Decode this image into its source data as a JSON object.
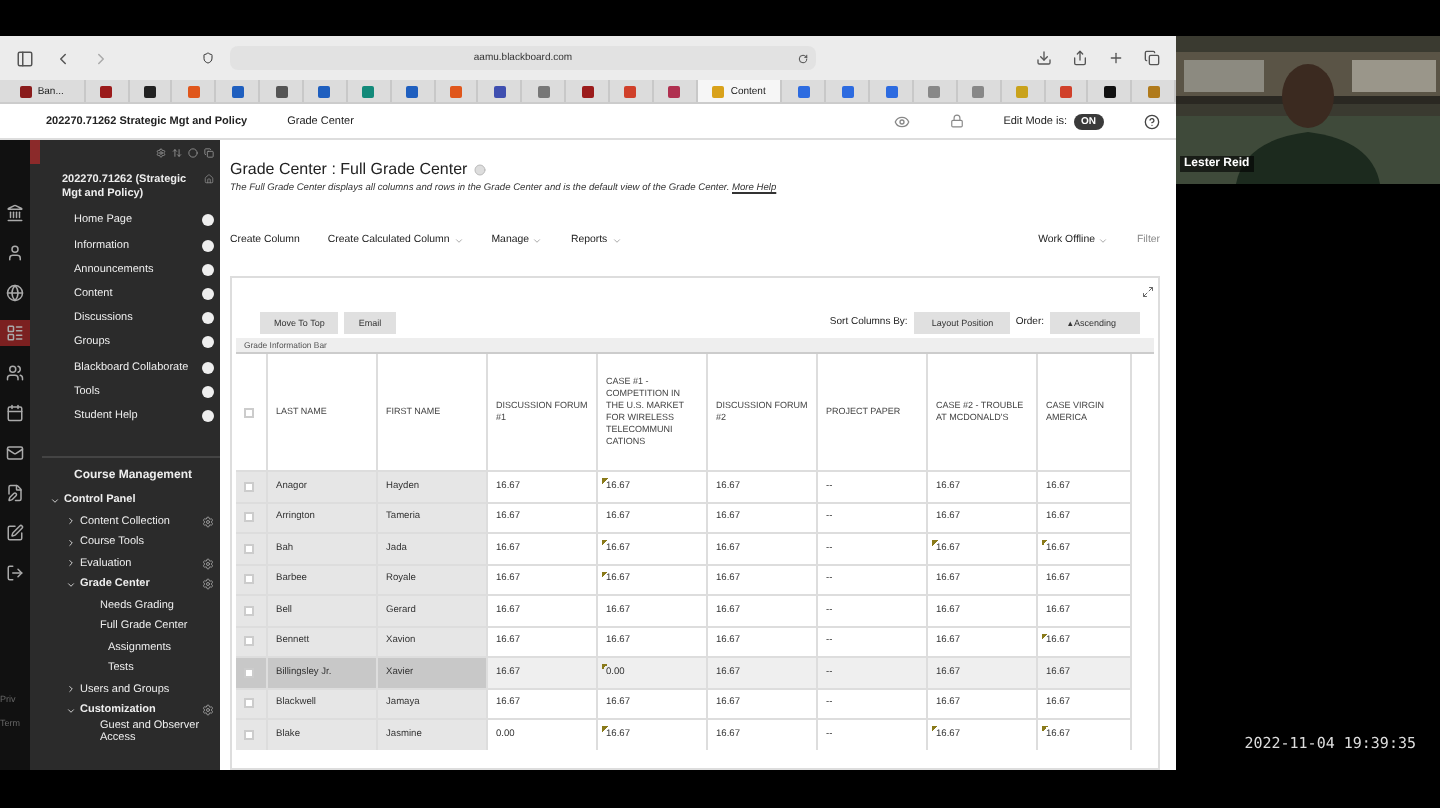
{
  "browser": {
    "address": "aamu.blackboard.com",
    "tabs": [
      {
        "label": "Ban...",
        "selected": false,
        "color": "#8a1c1c"
      },
      {
        "selected": false,
        "color": "#9b1b1b"
      },
      {
        "selected": false,
        "color": "#222222"
      },
      {
        "selected": false,
        "color": "#e0561b"
      },
      {
        "selected": false,
        "color": "#1f5fbf"
      },
      {
        "selected": false,
        "color": "#555555"
      },
      {
        "selected": false,
        "color": "#1f5fbf"
      },
      {
        "selected": false,
        "color": "#138a7a"
      },
      {
        "selected": false,
        "color": "#1f5fbf"
      },
      {
        "selected": false,
        "color": "#e0561b"
      },
      {
        "selected": false,
        "color": "#3f4fb0"
      },
      {
        "selected": false,
        "color": "#777777"
      },
      {
        "selected": false,
        "color": "#9b1b1b"
      },
      {
        "selected": false,
        "color": "#d0402a"
      },
      {
        "selected": false,
        "color": "#b03050"
      },
      {
        "label": "Content",
        "selected": true,
        "color": "#d9a21b"
      },
      {
        "selected": false,
        "color": "#2d6be0"
      },
      {
        "selected": false,
        "color": "#2d6be0"
      },
      {
        "selected": false,
        "color": "#2d6be0"
      },
      {
        "selected": false,
        "color": "#888888"
      },
      {
        "selected": false,
        "color": "#888888"
      },
      {
        "selected": false,
        "color": "#c9a21b"
      },
      {
        "selected": false,
        "color": "#d0402a"
      },
      {
        "selected": false,
        "color": "#111111"
      },
      {
        "selected": false,
        "color": "#b07a1b"
      }
    ]
  },
  "header": {
    "course": "202270.71262 Strategic Mgt and Policy",
    "crumb": "Grade Center",
    "edit_mode_label": "Edit Mode is:",
    "edit_mode_on": true,
    "edit_mode_text": "ON"
  },
  "rail": {
    "footer": [
      "Priv",
      "Term"
    ]
  },
  "sidebar": {
    "course_title": "202270.71262 (Strategic Mgt and Policy)",
    "menu": [
      "Home Page",
      "Information",
      "Announcements",
      "Content",
      "Discussions",
      "Groups",
      "Blackboard Collaborate",
      "Tools",
      "Student Help"
    ],
    "management_title": "Course Management",
    "tree": [
      {
        "label": "Control Panel",
        "expanded": true,
        "children": [
          {
            "label": "Content Collection",
            "expanded": false,
            "gear": true
          },
          {
            "label": "Course Tools",
            "expanded": false,
            "gear": false
          },
          {
            "label": "Evaluation",
            "expanded": false,
            "gear": true
          },
          {
            "label": "Grade Center",
            "expanded": true,
            "gear": true,
            "children": [
              {
                "label": "Needs Grading"
              },
              {
                "label": "Full Grade Center",
                "children": [
                  {
                    "label": "Assignments"
                  },
                  {
                    "label": "Tests"
                  }
                ]
              }
            ]
          },
          {
            "label": "Users and Groups",
            "expanded": false,
            "gear": false
          },
          {
            "label": "Customization",
            "expanded": true,
            "gear": true,
            "children": [
              {
                "label": "Guest and Observer Access"
              }
            ]
          }
        ]
      }
    ]
  },
  "page": {
    "title": "Grade Center : Full Grade Center",
    "description": "The Full Grade Center displays all columns and rows in the Grade Center and is the default view of the Grade Center.",
    "help_link": "More Help",
    "actions": [
      {
        "label": "Create Column",
        "menu": false
      },
      {
        "label": "Create Calculated Column",
        "menu": true
      },
      {
        "label": "Manage",
        "menu": true
      },
      {
        "label": "Reports",
        "menu": true
      }
    ],
    "right_actions": [
      {
        "label": "Work Offline",
        "menu": true
      },
      {
        "label": "Filter",
        "menu": false
      }
    ],
    "buttons": [
      "Move To Top",
      "Email"
    ],
    "sort_label": "Sort Columns By:",
    "sort_value": "Layout Position",
    "order_label": "Order:",
    "order_value": "▴Ascending",
    "info_bar": "Grade Information Bar"
  },
  "table": {
    "select_all_checked": false,
    "columns": [
      "LAST NAME",
      "FIRST NAME",
      "DISCUSSION FORUM #1",
      "CASE #1 - COMPETITION IN THE U.S. MARKET FOR WIRELESS TELECOMMUNI CATIONS",
      "DISCUSSION FORUM #2",
      "PROJECT PAPER",
      "CASE #2 - TROUBLE AT MCDONALD'S",
      "CASE VIRGIN AMERICA"
    ],
    "rows": [
      {
        "last": "Anagor",
        "first": "Hayden",
        "checked": false,
        "highlighted": false,
        "grades": [
          {
            "text": "16.67",
            "flag": false
          },
          {
            "text": "16.67",
            "flag": true
          },
          {
            "text": "16.67",
            "flag": false
          },
          {
            "text": "--",
            "flag": false
          },
          {
            "text": "16.67",
            "flag": false
          },
          {
            "text": "16.67",
            "flag": false
          }
        ]
      },
      {
        "last": "Arrington",
        "first": "Tameria",
        "checked": false,
        "highlighted": false,
        "grades": [
          {
            "text": "16.67",
            "flag": false
          },
          {
            "text": "16.67",
            "flag": false
          },
          {
            "text": "16.67",
            "flag": false
          },
          {
            "text": "--",
            "flag": false
          },
          {
            "text": "16.67",
            "flag": false
          },
          {
            "text": "16.67",
            "flag": false
          }
        ]
      },
      {
        "last": "Bah",
        "first": "Jada",
        "checked": false,
        "highlighted": false,
        "grades": [
          {
            "text": "16.67",
            "flag": false
          },
          {
            "text": "16.67",
            "flag": true
          },
          {
            "text": "16.67",
            "flag": false
          },
          {
            "text": "--",
            "flag": false
          },
          {
            "text": "16.67",
            "flag": true
          },
          {
            "text": "16.67",
            "flag": true
          }
        ]
      },
      {
        "last": "Barbee",
        "first": "Royale",
        "checked": false,
        "highlighted": false,
        "grades": [
          {
            "text": "16.67",
            "flag": false
          },
          {
            "text": "16.67",
            "flag": true
          },
          {
            "text": "16.67",
            "flag": false
          },
          {
            "text": "--",
            "flag": false
          },
          {
            "text": "16.67",
            "flag": false
          },
          {
            "text": "16.67",
            "flag": false
          }
        ]
      },
      {
        "last": "Bell",
        "first": "Gerard",
        "checked": false,
        "highlighted": false,
        "grades": [
          {
            "text": "16.67",
            "flag": false
          },
          {
            "text": "16.67",
            "flag": false
          },
          {
            "text": "16.67",
            "flag": false
          },
          {
            "text": "--",
            "flag": false
          },
          {
            "text": "16.67",
            "flag": false
          },
          {
            "text": "16.67",
            "flag": false
          }
        ]
      },
      {
        "last": "Bennett",
        "first": "Xavion",
        "checked": false,
        "highlighted": false,
        "grades": [
          {
            "text": "16.67",
            "flag": false
          },
          {
            "text": "16.67",
            "flag": false
          },
          {
            "text": "16.67",
            "flag": false
          },
          {
            "text": "--",
            "flag": false
          },
          {
            "text": "16.67",
            "flag": false
          },
          {
            "text": "16.67",
            "flag": true
          }
        ]
      },
      {
        "last": "Billingsley Jr.",
        "first": "Xavier",
        "checked": false,
        "highlighted": true,
        "grades": [
          {
            "text": "16.67",
            "flag": false
          },
          {
            "text": "0.00",
            "flag": true
          },
          {
            "text": "16.67",
            "flag": false
          },
          {
            "text": "--",
            "flag": false
          },
          {
            "text": "16.67",
            "flag": false
          },
          {
            "text": "16.67",
            "flag": false
          }
        ]
      },
      {
        "last": "Blackwell",
        "first": "Jamaya",
        "checked": false,
        "highlighted": false,
        "grades": [
          {
            "text": "16.67",
            "flag": false
          },
          {
            "text": "16.67",
            "flag": false
          },
          {
            "text": "16.67",
            "flag": false
          },
          {
            "text": "--",
            "flag": false
          },
          {
            "text": "16.67",
            "flag": false
          },
          {
            "text": "16.67",
            "flag": false
          }
        ]
      },
      {
        "last": "Blake",
        "first": "Jasmine",
        "checked": false,
        "highlighted": false,
        "grades": [
          {
            "text": "0.00",
            "flag": false
          },
          {
            "text": "16.67",
            "flag": true
          },
          {
            "text": "16.67",
            "flag": false
          },
          {
            "text": "--",
            "flag": false
          },
          {
            "text": "16.67",
            "flag": true
          },
          {
            "text": "16.67",
            "flag": true
          }
        ]
      }
    ]
  },
  "video": {
    "name": "Lester Reid"
  },
  "timestamp": "2022-11-04 19:39:35"
}
